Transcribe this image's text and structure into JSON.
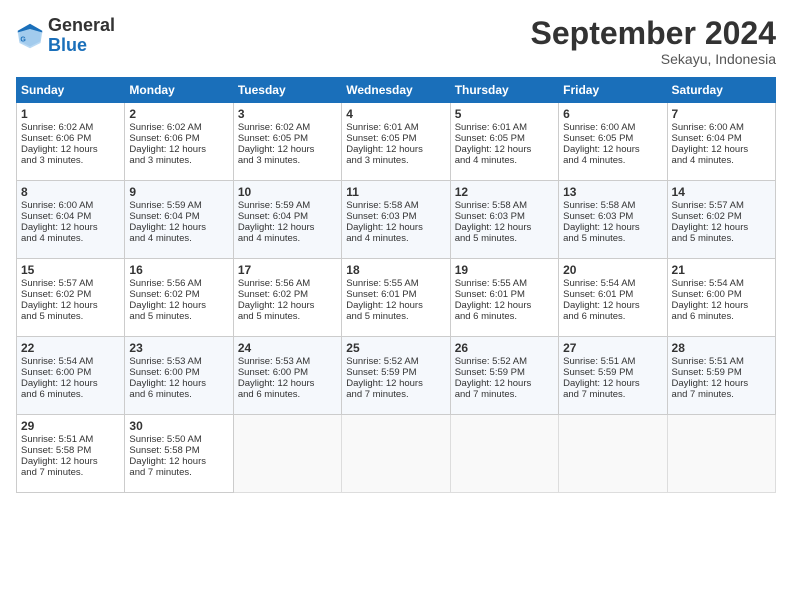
{
  "header": {
    "logo_general": "General",
    "logo_blue": "Blue",
    "month_title": "September 2024",
    "subtitle": "Sekayu, Indonesia"
  },
  "days_of_week": [
    "Sunday",
    "Monday",
    "Tuesday",
    "Wednesday",
    "Thursday",
    "Friday",
    "Saturday"
  ],
  "weeks": [
    [
      {
        "day": 1,
        "lines": [
          "Sunrise: 6:02 AM",
          "Sunset: 6:06 PM",
          "Daylight: 12 hours",
          "and 3 minutes."
        ]
      },
      {
        "day": 2,
        "lines": [
          "Sunrise: 6:02 AM",
          "Sunset: 6:06 PM",
          "Daylight: 12 hours",
          "and 3 minutes."
        ]
      },
      {
        "day": 3,
        "lines": [
          "Sunrise: 6:02 AM",
          "Sunset: 6:05 PM",
          "Daylight: 12 hours",
          "and 3 minutes."
        ]
      },
      {
        "day": 4,
        "lines": [
          "Sunrise: 6:01 AM",
          "Sunset: 6:05 PM",
          "Daylight: 12 hours",
          "and 3 minutes."
        ]
      },
      {
        "day": 5,
        "lines": [
          "Sunrise: 6:01 AM",
          "Sunset: 6:05 PM",
          "Daylight: 12 hours",
          "and 4 minutes."
        ]
      },
      {
        "day": 6,
        "lines": [
          "Sunrise: 6:00 AM",
          "Sunset: 6:05 PM",
          "Daylight: 12 hours",
          "and 4 minutes."
        ]
      },
      {
        "day": 7,
        "lines": [
          "Sunrise: 6:00 AM",
          "Sunset: 6:04 PM",
          "Daylight: 12 hours",
          "and 4 minutes."
        ]
      }
    ],
    [
      {
        "day": 8,
        "lines": [
          "Sunrise: 6:00 AM",
          "Sunset: 6:04 PM",
          "Daylight: 12 hours",
          "and 4 minutes."
        ]
      },
      {
        "day": 9,
        "lines": [
          "Sunrise: 5:59 AM",
          "Sunset: 6:04 PM",
          "Daylight: 12 hours",
          "and 4 minutes."
        ]
      },
      {
        "day": 10,
        "lines": [
          "Sunrise: 5:59 AM",
          "Sunset: 6:04 PM",
          "Daylight: 12 hours",
          "and 4 minutes."
        ]
      },
      {
        "day": 11,
        "lines": [
          "Sunrise: 5:58 AM",
          "Sunset: 6:03 PM",
          "Daylight: 12 hours",
          "and 4 minutes."
        ]
      },
      {
        "day": 12,
        "lines": [
          "Sunrise: 5:58 AM",
          "Sunset: 6:03 PM",
          "Daylight: 12 hours",
          "and 5 minutes."
        ]
      },
      {
        "day": 13,
        "lines": [
          "Sunrise: 5:58 AM",
          "Sunset: 6:03 PM",
          "Daylight: 12 hours",
          "and 5 minutes."
        ]
      },
      {
        "day": 14,
        "lines": [
          "Sunrise: 5:57 AM",
          "Sunset: 6:02 PM",
          "Daylight: 12 hours",
          "and 5 minutes."
        ]
      }
    ],
    [
      {
        "day": 15,
        "lines": [
          "Sunrise: 5:57 AM",
          "Sunset: 6:02 PM",
          "Daylight: 12 hours",
          "and 5 minutes."
        ]
      },
      {
        "day": 16,
        "lines": [
          "Sunrise: 5:56 AM",
          "Sunset: 6:02 PM",
          "Daylight: 12 hours",
          "and 5 minutes."
        ]
      },
      {
        "day": 17,
        "lines": [
          "Sunrise: 5:56 AM",
          "Sunset: 6:02 PM",
          "Daylight: 12 hours",
          "and 5 minutes."
        ]
      },
      {
        "day": 18,
        "lines": [
          "Sunrise: 5:55 AM",
          "Sunset: 6:01 PM",
          "Daylight: 12 hours",
          "and 5 minutes."
        ]
      },
      {
        "day": 19,
        "lines": [
          "Sunrise: 5:55 AM",
          "Sunset: 6:01 PM",
          "Daylight: 12 hours",
          "and 6 minutes."
        ]
      },
      {
        "day": 20,
        "lines": [
          "Sunrise: 5:54 AM",
          "Sunset: 6:01 PM",
          "Daylight: 12 hours",
          "and 6 minutes."
        ]
      },
      {
        "day": 21,
        "lines": [
          "Sunrise: 5:54 AM",
          "Sunset: 6:00 PM",
          "Daylight: 12 hours",
          "and 6 minutes."
        ]
      }
    ],
    [
      {
        "day": 22,
        "lines": [
          "Sunrise: 5:54 AM",
          "Sunset: 6:00 PM",
          "Daylight: 12 hours",
          "and 6 minutes."
        ]
      },
      {
        "day": 23,
        "lines": [
          "Sunrise: 5:53 AM",
          "Sunset: 6:00 PM",
          "Daylight: 12 hours",
          "and 6 minutes."
        ]
      },
      {
        "day": 24,
        "lines": [
          "Sunrise: 5:53 AM",
          "Sunset: 6:00 PM",
          "Daylight: 12 hours",
          "and 6 minutes."
        ]
      },
      {
        "day": 25,
        "lines": [
          "Sunrise: 5:52 AM",
          "Sunset: 5:59 PM",
          "Daylight: 12 hours",
          "and 7 minutes."
        ]
      },
      {
        "day": 26,
        "lines": [
          "Sunrise: 5:52 AM",
          "Sunset: 5:59 PM",
          "Daylight: 12 hours",
          "and 7 minutes."
        ]
      },
      {
        "day": 27,
        "lines": [
          "Sunrise: 5:51 AM",
          "Sunset: 5:59 PM",
          "Daylight: 12 hours",
          "and 7 minutes."
        ]
      },
      {
        "day": 28,
        "lines": [
          "Sunrise: 5:51 AM",
          "Sunset: 5:59 PM",
          "Daylight: 12 hours",
          "and 7 minutes."
        ]
      }
    ],
    [
      {
        "day": 29,
        "lines": [
          "Sunrise: 5:51 AM",
          "Sunset: 5:58 PM",
          "Daylight: 12 hours",
          "and 7 minutes."
        ]
      },
      {
        "day": 30,
        "lines": [
          "Sunrise: 5:50 AM",
          "Sunset: 5:58 PM",
          "Daylight: 12 hours",
          "and 7 minutes."
        ]
      },
      null,
      null,
      null,
      null,
      null
    ]
  ]
}
